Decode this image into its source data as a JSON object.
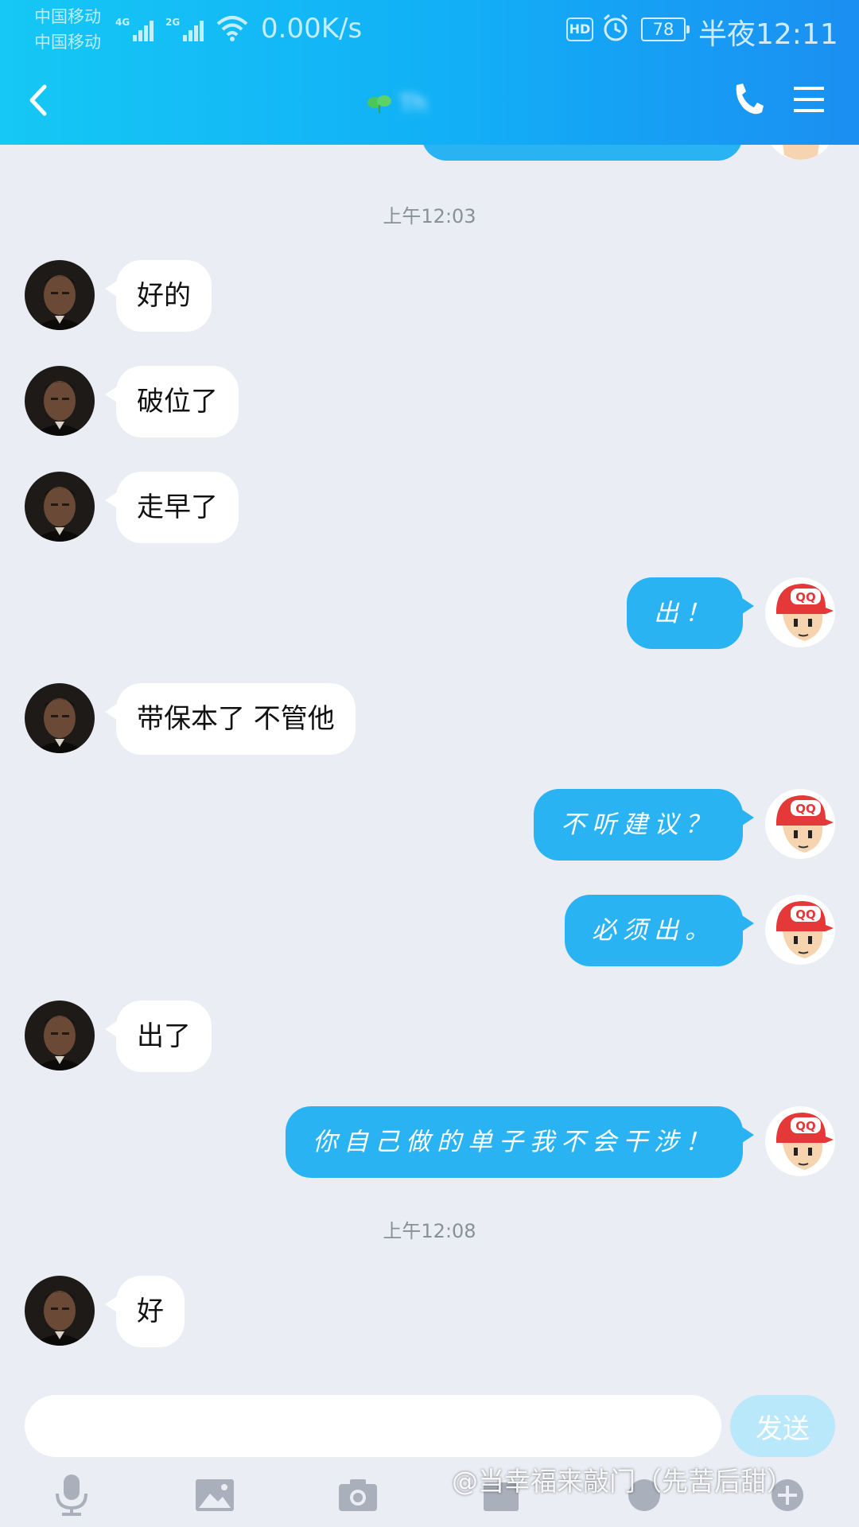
{
  "status_bar": {
    "carrier_1": "中国移动",
    "carrier_2": "中国移动",
    "net_1": "4G",
    "net_2": "2G",
    "net_speed": "0.00K/s",
    "hd": "HD",
    "battery": "78",
    "time": "半夜12:11"
  },
  "header": {
    "back_icon": "chevron-left-icon",
    "title_obscured": "Th",
    "phone_icon": "phone-icon",
    "menu_icon": "menu-icon"
  },
  "messages": [
    {
      "type": "timestamp",
      "text": "上午12:03"
    },
    {
      "type": "in",
      "text": "好的"
    },
    {
      "type": "in",
      "text": "破位了"
    },
    {
      "type": "in",
      "text": "走早了"
    },
    {
      "type": "out",
      "text": "出！"
    },
    {
      "type": "in",
      "text": "带保本了 不管他"
    },
    {
      "type": "out",
      "text": "不听建议？"
    },
    {
      "type": "out",
      "text": "必须出。"
    },
    {
      "type": "in",
      "text": "出了"
    },
    {
      "type": "out",
      "text": "你自己做的单子我不会干涉！"
    },
    {
      "type": "timestamp",
      "text": "上午12:08"
    },
    {
      "type": "in",
      "text": "好"
    }
  ],
  "input": {
    "value": "",
    "placeholder": "",
    "send_label": "发送"
  },
  "toolbar": [
    "microphone-icon",
    "image-icon",
    "camera-icon",
    "folder-icon",
    "emoji-icon",
    "plus-icon"
  ],
  "watermark": "@当幸福来敲门（先苦后甜）",
  "colors": {
    "header_start": "#15c8f5",
    "header_end": "#1b8ff2",
    "outgoing_bubble": "#2ab3f3",
    "incoming_bubble": "#ffffff",
    "background": "#eaedf4",
    "send_button": "#b9e8fb"
  }
}
